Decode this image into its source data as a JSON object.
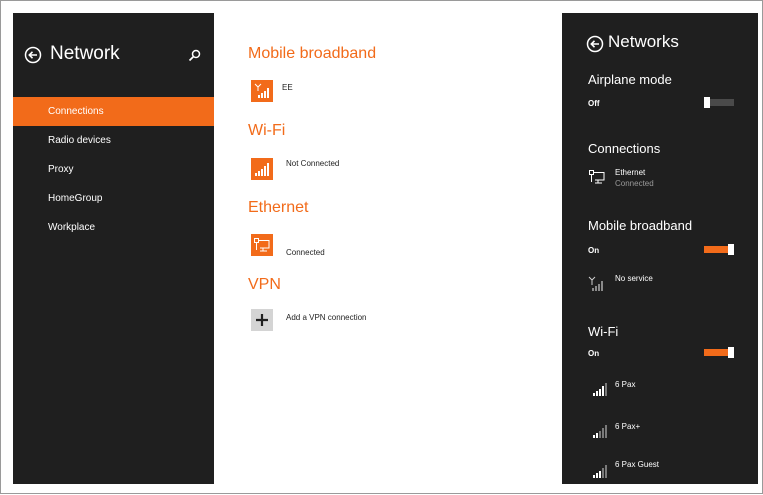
{
  "sidebar": {
    "title": "Network",
    "items": [
      {
        "label": "Connections",
        "active": true
      },
      {
        "label": "Radio devices",
        "active": false
      },
      {
        "label": "Proxy",
        "active": false
      },
      {
        "label": "HomeGroup",
        "active": false
      },
      {
        "label": "Workplace",
        "active": false
      }
    ]
  },
  "main": {
    "mobile_broadband": {
      "title": "Mobile broadband",
      "item_label": "EE"
    },
    "wifi": {
      "title": "Wi-Fi",
      "item_label": "Not Connected"
    },
    "ethernet": {
      "title": "Ethernet",
      "item_label": "Connected"
    },
    "vpn": {
      "title": "VPN",
      "item_label": "Add a VPN connection"
    }
  },
  "charm": {
    "title": "Networks",
    "airplane": {
      "title": "Airplane mode",
      "state": "Off"
    },
    "connections": {
      "title": "Connections",
      "name": "Ethernet",
      "status": "Connected"
    },
    "mobile": {
      "title": "Mobile broadband",
      "state": "On",
      "item_label": "No service"
    },
    "wifi": {
      "title": "Wi-Fi",
      "state": "On",
      "networks": [
        {
          "name": "6 Pax"
        },
        {
          "name": "6 Pax+"
        },
        {
          "name": "6 Pax Guest"
        }
      ]
    }
  },
  "colors": {
    "accent": "#f26b1a",
    "panel": "#1f1f1f"
  },
  "icons": [
    "back-arrow-icon",
    "search-icon",
    "signal-icon",
    "ethernet-icon",
    "plus-icon"
  ]
}
